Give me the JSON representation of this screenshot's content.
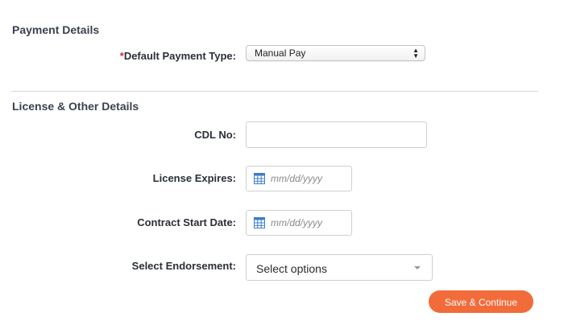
{
  "payment_section": {
    "title": "Payment Details",
    "payment_type": {
      "required_mark": "*",
      "label": "Default Payment Type:",
      "value": "Manual Pay"
    }
  },
  "license_section": {
    "title": "License & Other Details",
    "cdl": {
      "label": "CDL No:",
      "value": ""
    },
    "license_expires": {
      "label": "License Expires:",
      "placeholder": "mm/dd/yyyy",
      "icon": "calendar-icon"
    },
    "contract_start": {
      "label": "Contract Start Date:",
      "placeholder": "mm/dd/yyyy",
      "icon": "calendar-icon"
    },
    "endorsement": {
      "label": "Select Endorsement:",
      "value": "Select options",
      "icon": "chevron-down-icon"
    }
  },
  "actions": {
    "save_label": "Save & Continue"
  },
  "colors": {
    "accent": "#f26b3a",
    "required": "#d0312d",
    "calendar_icon": "#3d7cc9"
  }
}
